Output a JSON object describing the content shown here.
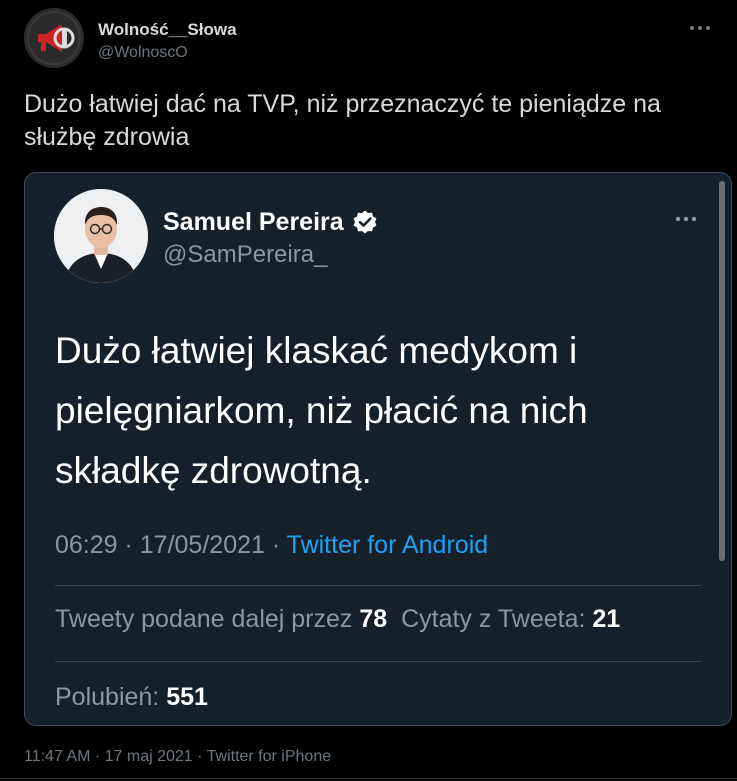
{
  "tweet": {
    "author_name": "Wolność__Słowa",
    "author_handle": "@WolnoscO",
    "text": "Dużo łatwiej dać na TVP, niż przeznaczyć te pieniądze na służbę zdrowia",
    "meta": "11:47 AM · 17 maj 2021 · Twitter for iPhone",
    "more_icon": "more-icon"
  },
  "quoted": {
    "author_name": "Samuel Pereira",
    "verified_icon": "verified-badge-icon",
    "author_handle": "@SamPereira_",
    "text": "Dużo łatwiej klaskać medykom i pielęgniarkom, niż płacić na nich składkę zdrowotną.",
    "time": "06:29 · 17/05/2021 · ",
    "source": "Twitter for Android",
    "retweets_label": "Tweety podane dalej przez ",
    "retweets_count": "78",
    "quotes_label": "Cytaty z Tweeta: ",
    "quotes_count": "21",
    "likes_label": "Polubień: ",
    "likes_count": "551"
  },
  "colors": {
    "background": "#000000",
    "card": "#15202b",
    "link": "#1da1f2",
    "verified": "#ffffff"
  }
}
